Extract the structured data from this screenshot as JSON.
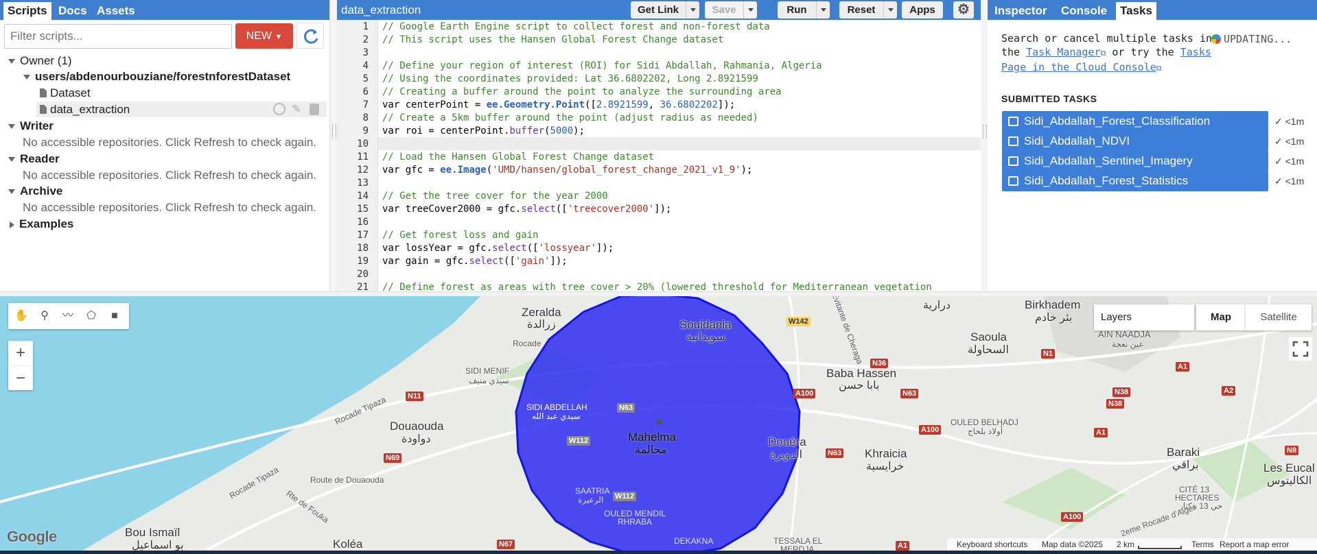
{
  "left_panel": {
    "tabs": [
      "Scripts",
      "Docs",
      "Assets"
    ],
    "filter_placeholder": "Filter scripts...",
    "new_label": "NEW",
    "tree": {
      "owner": "Owner (1)",
      "repo": "users/abdenourbouziane/forestnforestDataset",
      "files": [
        "Dataset",
        "data_extraction"
      ],
      "writer": "Writer",
      "reader": "Reader",
      "archive": "Archive",
      "examples": "Examples",
      "no_repo_msg": "No accessible repositories. Click Refresh to check again."
    }
  },
  "editor": {
    "filename": "data_extraction",
    "buttons": {
      "get_link": "Get Link",
      "save": "Save",
      "run": "Run",
      "reset": "Reset",
      "apps": "Apps"
    },
    "line_numbers": [
      "1",
      "2",
      "3",
      "4",
      "5",
      "6",
      "7",
      "8",
      "9",
      "10",
      "11",
      "12",
      "13",
      "14",
      "15",
      "16",
      "17",
      "18",
      "19",
      "20",
      "21"
    ],
    "code": {
      "l1": "// Google Earth Engine script to collect forest and non-forest data",
      "l2": "// This script uses the Hansen Global Forest Change dataset",
      "l4": "// Define your region of interest (ROI) for Sidi Abdallah, Rahmania, Algeria",
      "l5": "// Using the coordinates provided: Lat 36.6802202, Long 2.8921599",
      "l6": "// Creating a buffer around the point to analyze the surrounding area",
      "l7a": "var centerPoint = ",
      "l7b": "ee.Geometry.Point",
      "l7c": "([",
      "l7d": "2.8921599",
      "l7e": ", ",
      "l7f": "36.6802202",
      "l7g": "]);",
      "l8": "// Create a 5km buffer around the point (adjust radius as needed)",
      "l9a": "var roi = centerPoint.",
      "l9b": "buffer",
      "l9c": "(",
      "l9d": "5000",
      "l9e": ");",
      "l11": "// Load the Hansen Global Forest Change dataset",
      "l12a": "var gfc = ",
      "l12b": "ee.Image",
      "l12c": "(",
      "l12d": "'UMD/hansen/global_forest_change_2021_v1_9'",
      "l12e": ");",
      "l14": "// Get the tree cover for the year 2000",
      "l15a": "var treeCover2000 = gfc.",
      "l15b": "select",
      "l15c": "([",
      "l15d": "'treecover2000'",
      "l15e": "]);",
      "l17": "// Get forest loss and gain",
      "l18a": "var lossYear = gfc.",
      "l18b": "select",
      "l18c": "([",
      "l18d": "'lossyear'",
      "l18e": "]);",
      "l19a": "var gain = gfc.",
      "l19b": "select",
      "l19c": "([",
      "l19d": "'gain'",
      "l19e": "]);",
      "l21": "// Define forest as areas with tree cover > 20% (lowered threshold for Mediterranean vegetation"
    }
  },
  "right_panel": {
    "tabs": [
      "Inspector",
      "Console",
      "Tasks"
    ],
    "msg1": "Search or cancel multiple tasks in",
    "msg_the": "the ",
    "task_manager": "Task Manager",
    "or_try": " or try the ",
    "tasks_link": "Tasks",
    "page_link": "Page in the Cloud Console",
    "updating": "UPDATING...",
    "submitted": "SUBMITTED TASKS",
    "tasks": [
      {
        "name": "Sidi_Abdallah_Forest_Classification",
        "time": "<1m"
      },
      {
        "name": "Sidi_Abdallah_NDVI",
        "time": "<1m"
      },
      {
        "name": "Sidi_Abdallah_Sentinel_Imagery",
        "time": "<1m"
      },
      {
        "name": "Sidi_Abdallah_Forest_Statistics",
        "time": "<1m"
      }
    ]
  },
  "map": {
    "layers": "Layers",
    "map_btn": "Map",
    "satellite_btn": "Satellite",
    "labels": {
      "zeralda": "Zeralda",
      "zeralda_ar": "زرالدة",
      "souidania": "Souidania",
      "souidania_ar": "سويدانية",
      "birkhadem": "Birkhadem",
      "birkhadem_ar": "بئر خادم",
      "saoula": "Saoula",
      "saoula_ar": "السحاولة",
      "ain_naadja": "AIN NAADJA",
      "ain_naadja_ar": "عين نعجة",
      "baba_hassen": "Baba Hassen",
      "baba_hassen_ar": "بابا حسن",
      "sidi_menif": "SIDI MENIF",
      "sidi_menif_ar": "سيدي منيف",
      "sidi_abdellah": "SIDI ABDELLAH",
      "sidi_abdellah_ar": "سيدي عبد الله",
      "douaouda": "Douaouda",
      "douaouda_ar": "دواودة",
      "mahelma": "Mahelma",
      "mahelma_ar": "محالمة",
      "douera": "Douéra",
      "douera_ar": "الدويرة",
      "khraicia": "Khraicia",
      "khraicia_ar": "خرايسية",
      "ouled_belhadj": "OULED BELHADJ",
      "ouled_belhadj_ar": "أولاد بلحاج",
      "baraki": "Baraki",
      "baraki_ar": "براقي",
      "les_eucal": "Les Eucal",
      "les_eucal_ar": "الكاليتوس",
      "cite13": "CITÉ 13",
      "hectares": "HECTARES",
      "cite13_ar": "حي 13 هكتار",
      "saatria": "SAATRIA",
      "saatria_ar": "الرعيرة",
      "ouled_mendil": "OULED MENDIL",
      "rhraba": "RHRABA",
      "dekakna": "DEKAKNA",
      "tessala": "TESSALA EL",
      "merdja": "MERDJA",
      "bou_ismail": "Bou Ismaïl",
      "bou_ismail_ar": "بو اسماعيل",
      "kolea": "Koléa",
      "draria_ar": "درارية",
      "rocade_tipaza": "Rocade Tipaza",
      "rocade_tipaza2": "Rocade Tipaza",
      "route_douaouda": "Route de Douaouda",
      "rte_fouka": "Rte de Fouka",
      "rocade_alger": "2eme Rocade d'Alger",
      "rocade_alger2": "2eme Rocade d'Alger",
      "rocade_short": "Rocade",
      "evitante": "Evitante de Cheraga"
    },
    "roads": [
      "W142",
      "N1",
      "N36",
      "N63",
      "A100",
      "N11",
      "N63",
      "A100",
      "N63",
      "A1",
      "N38",
      "N38",
      "A2",
      "A1",
      "N69",
      "W112",
      "W112",
      "A100",
      "N67",
      "A1",
      "N8"
    ],
    "attribution": {
      "keyboard": "Keyboard shortcuts",
      "data": "Map data ©2025",
      "scale": "2 km",
      "terms": "Terms",
      "report": "Report a map error"
    },
    "google": "Google"
  },
  "colors": {
    "header_blue": "#3f7fd0",
    "new_red": "#d9493a",
    "buffer_blue": "#2d2df0",
    "task_blue": "#3d7fd8"
  }
}
